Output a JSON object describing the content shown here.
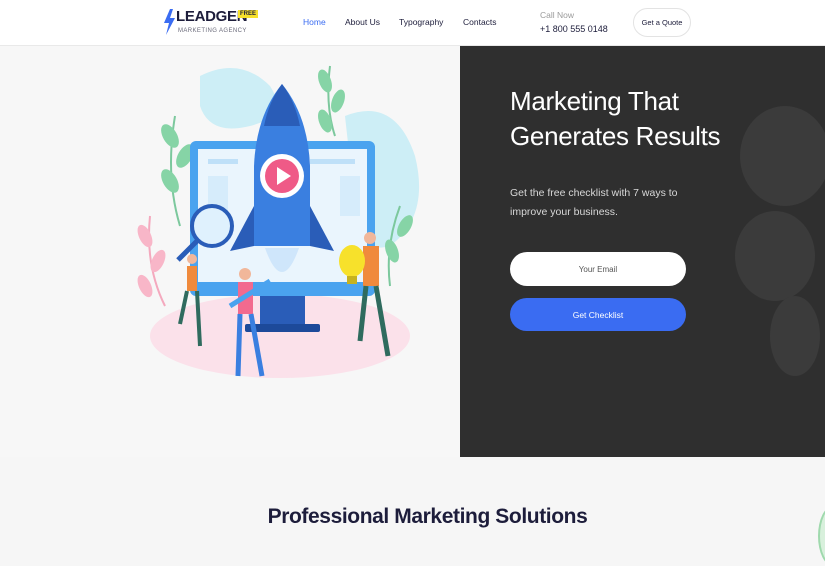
{
  "brand": {
    "name": "LEADGEN",
    "badge": "FREE",
    "tagline": "MARKETING AGENCY",
    "accent_color": "#3a6cf2"
  },
  "nav": {
    "items": [
      {
        "label": "Home",
        "active": true
      },
      {
        "label": "About Us",
        "active": false
      },
      {
        "label": "Typography",
        "active": false
      },
      {
        "label": "Contacts",
        "active": false
      }
    ]
  },
  "contact": {
    "label": "Call Now",
    "phone": "+1 800 555 0148"
  },
  "header_button": "Get a Quote",
  "hero": {
    "title": "Marketing That Generates Results",
    "subtitle": "Get the free checklist with 7 ways to improve your business.",
    "email_placeholder": "Your Email",
    "cta_label": "Get Checklist",
    "background_color": "#2f2f2f"
  },
  "illustration": {
    "icon": "rocket-launch-illustration"
  },
  "section": {
    "title": "Professional Marketing Solutions"
  }
}
